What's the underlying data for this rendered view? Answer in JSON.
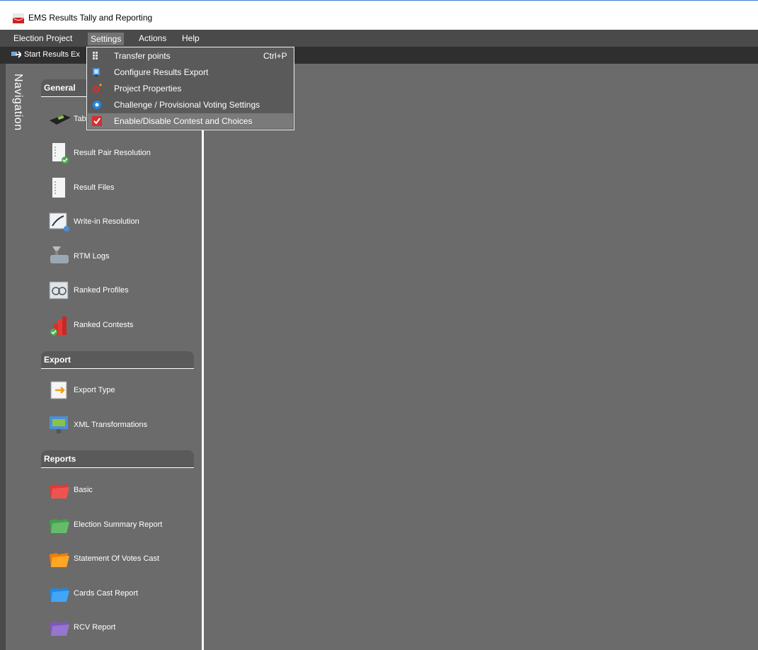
{
  "window": {
    "title": "EMS Results Tally and Reporting"
  },
  "menubar": {
    "items": [
      "Election Project",
      "Settings",
      "Actions",
      "Help"
    ]
  },
  "toolbar": {
    "start_label": "Start Results Ex"
  },
  "settings_menu": {
    "items": [
      {
        "label": "Transfer points",
        "shortcut": "Ctrl+P",
        "icon": "transfer-points-icon"
      },
      {
        "label": "Configure Results Export",
        "shortcut": "",
        "icon": "configure-export-icon"
      },
      {
        "label": "Project Properties",
        "shortcut": "",
        "icon": "project-properties-icon"
      },
      {
        "label": "Challenge / Provisional Voting Settings",
        "shortcut": "",
        "icon": "challenge-settings-icon"
      },
      {
        "label": "Enable/Disable Contest and Choices",
        "shortcut": "",
        "icon": "checkbox-icon"
      }
    ]
  },
  "navigation": {
    "label": "Navigation",
    "sections": {
      "general": {
        "title": "General",
        "items": [
          "Tab",
          "Result Pair Resolution",
          "Result Files",
          "Write-in Resolution",
          "RTM Logs",
          "Ranked Profiles",
          "Ranked Contests"
        ]
      },
      "export": {
        "title": "Export",
        "items": [
          "Export Type",
          "XML Transformations"
        ]
      },
      "reports": {
        "title": "Reports",
        "items": [
          "Basic",
          "Election Summary Report",
          "Statement Of Votes Cast",
          "Cards Cast Report",
          "RCV Report"
        ]
      }
    }
  },
  "colors": {
    "menubar_bg": "#4a4a4a",
    "panel_bg": "#6b6b6b",
    "toolbar_bg": "#2f2f2f",
    "menu_highlight": "#7a7a7a"
  }
}
